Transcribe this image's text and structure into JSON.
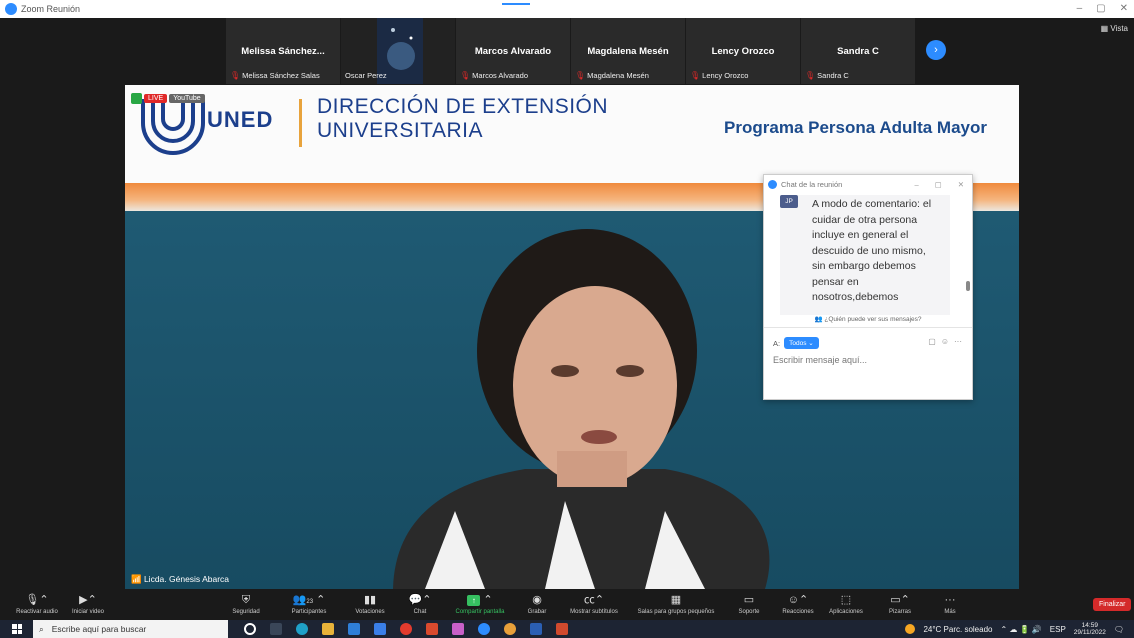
{
  "window": {
    "title": "Zoom Reunión",
    "controls": [
      "–",
      "▢",
      "✕"
    ]
  },
  "strip": {
    "tiles": [
      {
        "name": "Melissa Sánchez...",
        "sub": "Melissa Sánchez Salas",
        "muted": true
      },
      {
        "name": "",
        "sub": "Oscar Perez",
        "muted": false,
        "photo": true
      },
      {
        "name": "Marcos Alvarado",
        "sub": "Marcos Alvarado",
        "muted": true
      },
      {
        "name": "Magdalena Mesén",
        "sub": "Magdalena Mesén",
        "muted": true
      },
      {
        "name": "Lency Orozco",
        "sub": "Lency Orozco",
        "muted": true
      },
      {
        "name": "Sandra C",
        "sub": "Sandra C",
        "muted": true
      }
    ],
    "next_glyph": "›",
    "view_label": "Vista"
  },
  "slide": {
    "live_label": "LIVE",
    "youtube_label": "YouTube",
    "logo_text": "UNED",
    "direction_line1": "DIRECCIÓN DE EXTENSIÓN",
    "direction_line2": "UNIVERSITARIA",
    "program": "Programa Persona Adulta Mayor",
    "speaker": "Licda. Génesis Abarca"
  },
  "chat": {
    "title": "Chat de la reunión",
    "avatar": "JP",
    "message": "A modo de comentario: el cuidar de otra persona incluye en general el descuido de uno mismo, sin embargo debemos pensar en nosotros,debemos",
    "who_can_see": "¿Quién puede ver sus mensajes?",
    "to_label": "A:",
    "to_value": "Todos",
    "placeholder": "Escribir mensaje aquí..."
  },
  "toolbar": {
    "buttons": [
      {
        "label": "Reactivar audio",
        "icon": "mic-off-icon"
      },
      {
        "label": "Iniciar video",
        "icon": "video-off-icon"
      },
      {
        "label": "Seguridad",
        "icon": "shield-icon"
      },
      {
        "label": "Participantes",
        "icon": "participants-icon",
        "count": "23"
      },
      {
        "label": "Votaciones",
        "icon": "poll-icon"
      },
      {
        "label": "Chat",
        "icon": "chat-icon"
      },
      {
        "label": "Compartir pantalla",
        "icon": "share-screen-icon"
      },
      {
        "label": "Grabar",
        "icon": "record-icon"
      },
      {
        "label": "Mostrar subtítulos",
        "icon": "cc-icon"
      },
      {
        "label": "Salas para grupos pequeños",
        "icon": "breakout-icon"
      },
      {
        "label": "Soporte",
        "icon": "support-icon"
      },
      {
        "label": "Reacciones",
        "icon": "reactions-icon"
      },
      {
        "label": "Aplicaciones",
        "icon": "apps-icon"
      },
      {
        "label": "Pizarras",
        "icon": "whiteboard-icon"
      },
      {
        "label": "Más",
        "icon": "more-icon"
      }
    ],
    "end_label": "Finalizar"
  },
  "taskbar": {
    "search_placeholder": "Escribe aquí para buscar",
    "weather": "24°C  Parc. soleado",
    "lang": "ESP",
    "time": "14:59",
    "date": "29/11/2022"
  },
  "colors": {
    "zoom_blue": "#2d8cff",
    "live_red": "#e02828",
    "end_red": "#d42a2a",
    "share_green": "#36c061"
  }
}
